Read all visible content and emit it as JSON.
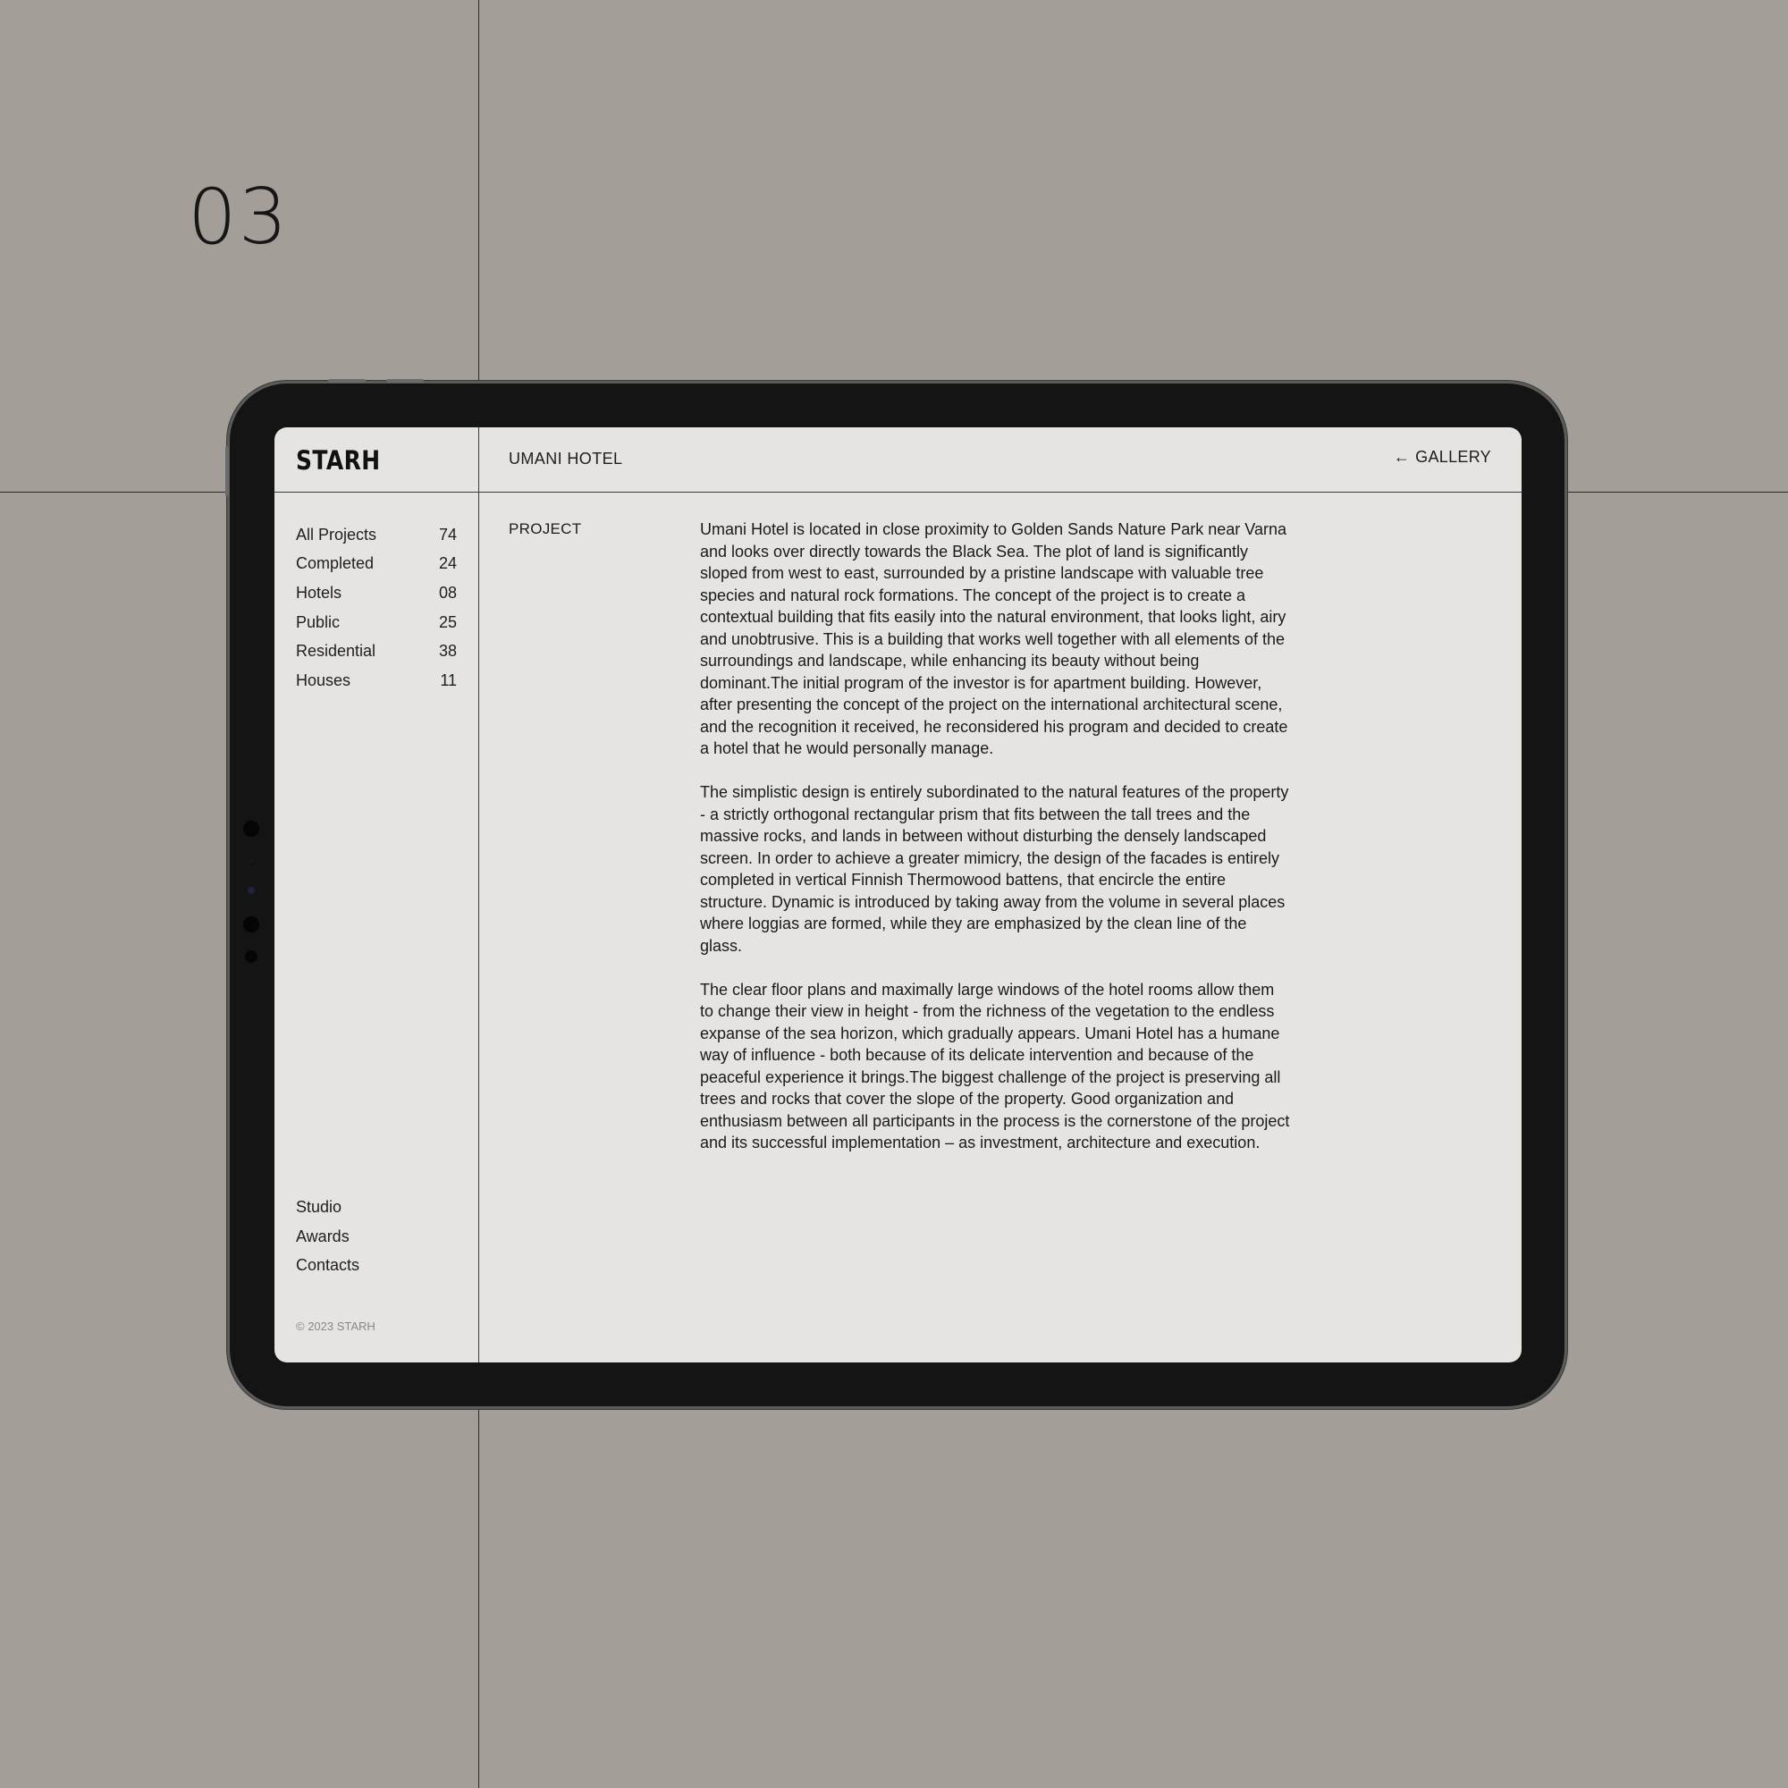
{
  "slide_number": "03",
  "brand": {
    "logo": "STARH"
  },
  "header": {
    "project_title": "UMANI HOTEL",
    "gallery_link": {
      "icon": "arrow-left-icon",
      "label": "GALLERY"
    }
  },
  "sidebar": {
    "categories": [
      {
        "label": "All Projects",
        "count": "74"
      },
      {
        "label": "Completed",
        "count": "24"
      },
      {
        "label": "Hotels",
        "count": "08"
      },
      {
        "label": "Public",
        "count": "25"
      },
      {
        "label": "Residential",
        "count": "38"
      },
      {
        "label": "Houses",
        "count": "11"
      }
    ],
    "links": [
      "Studio",
      "Awards",
      "Contacts"
    ],
    "copyright": "© 2023 STARH"
  },
  "main": {
    "section_label": "PROJECT",
    "paragraphs": [
      "Umani Hotel is located in close proximity to Golden Sands Nature Park near Varna and looks over directly towards the Black Sea. The plot of land is significantly sloped from west to east, surrounded by a pristine landscape with valuable tree species and natural rock formations. The concept of the project is to create a contextual building that fits easily into the natural environment, that looks light, airy and unobtrusive. This is a building that works well together with all elements of the surroundings and landscape, while enhancing its beauty without being dominant.The initial program of the investor is for apartment building. However, after presenting the concept of the project on the international architectural scene, and the recognition it received, he reconsidered his program and decided to create a hotel that he would personally manage.",
      "The simplistic design is entirely subordinated to the natural features of the property - a strictly orthogonal rectangular prism that fits between the tall trees and the massive rocks, and lands in between without disturbing the densely landscaped screen. In order to achieve a greater mimicry, the design of the facades is entirely completed in vertical Finnish Thermowood battens, that encircle the entire structure. Dynamic is introduced by taking away from the volume in several places where loggias are formed, while they are emphasized by the clean line of the glass.",
      "The clear floor plans and maximally large windows of the hotel rooms allow them to change their view in height - from the richness of the vegetation to the endless expanse of the sea horizon, which gradually appears. Umani Hotel has a humane way of influence - both because of its delicate intervention and because of the peaceful experience it brings.The biggest challenge of the project is preserving all trees and rocks that cover the slope of the property. Good organization and enthusiasm between all participants in the process is the cornerstone of the project and its successful implementation – as investment, architecture and execution."
    ]
  },
  "colors": {
    "background": "#a39f98",
    "device_frame": "#141414",
    "screen": "#e5e4e0",
    "text": "#1a1a1a",
    "muted_text": "#888888"
  }
}
